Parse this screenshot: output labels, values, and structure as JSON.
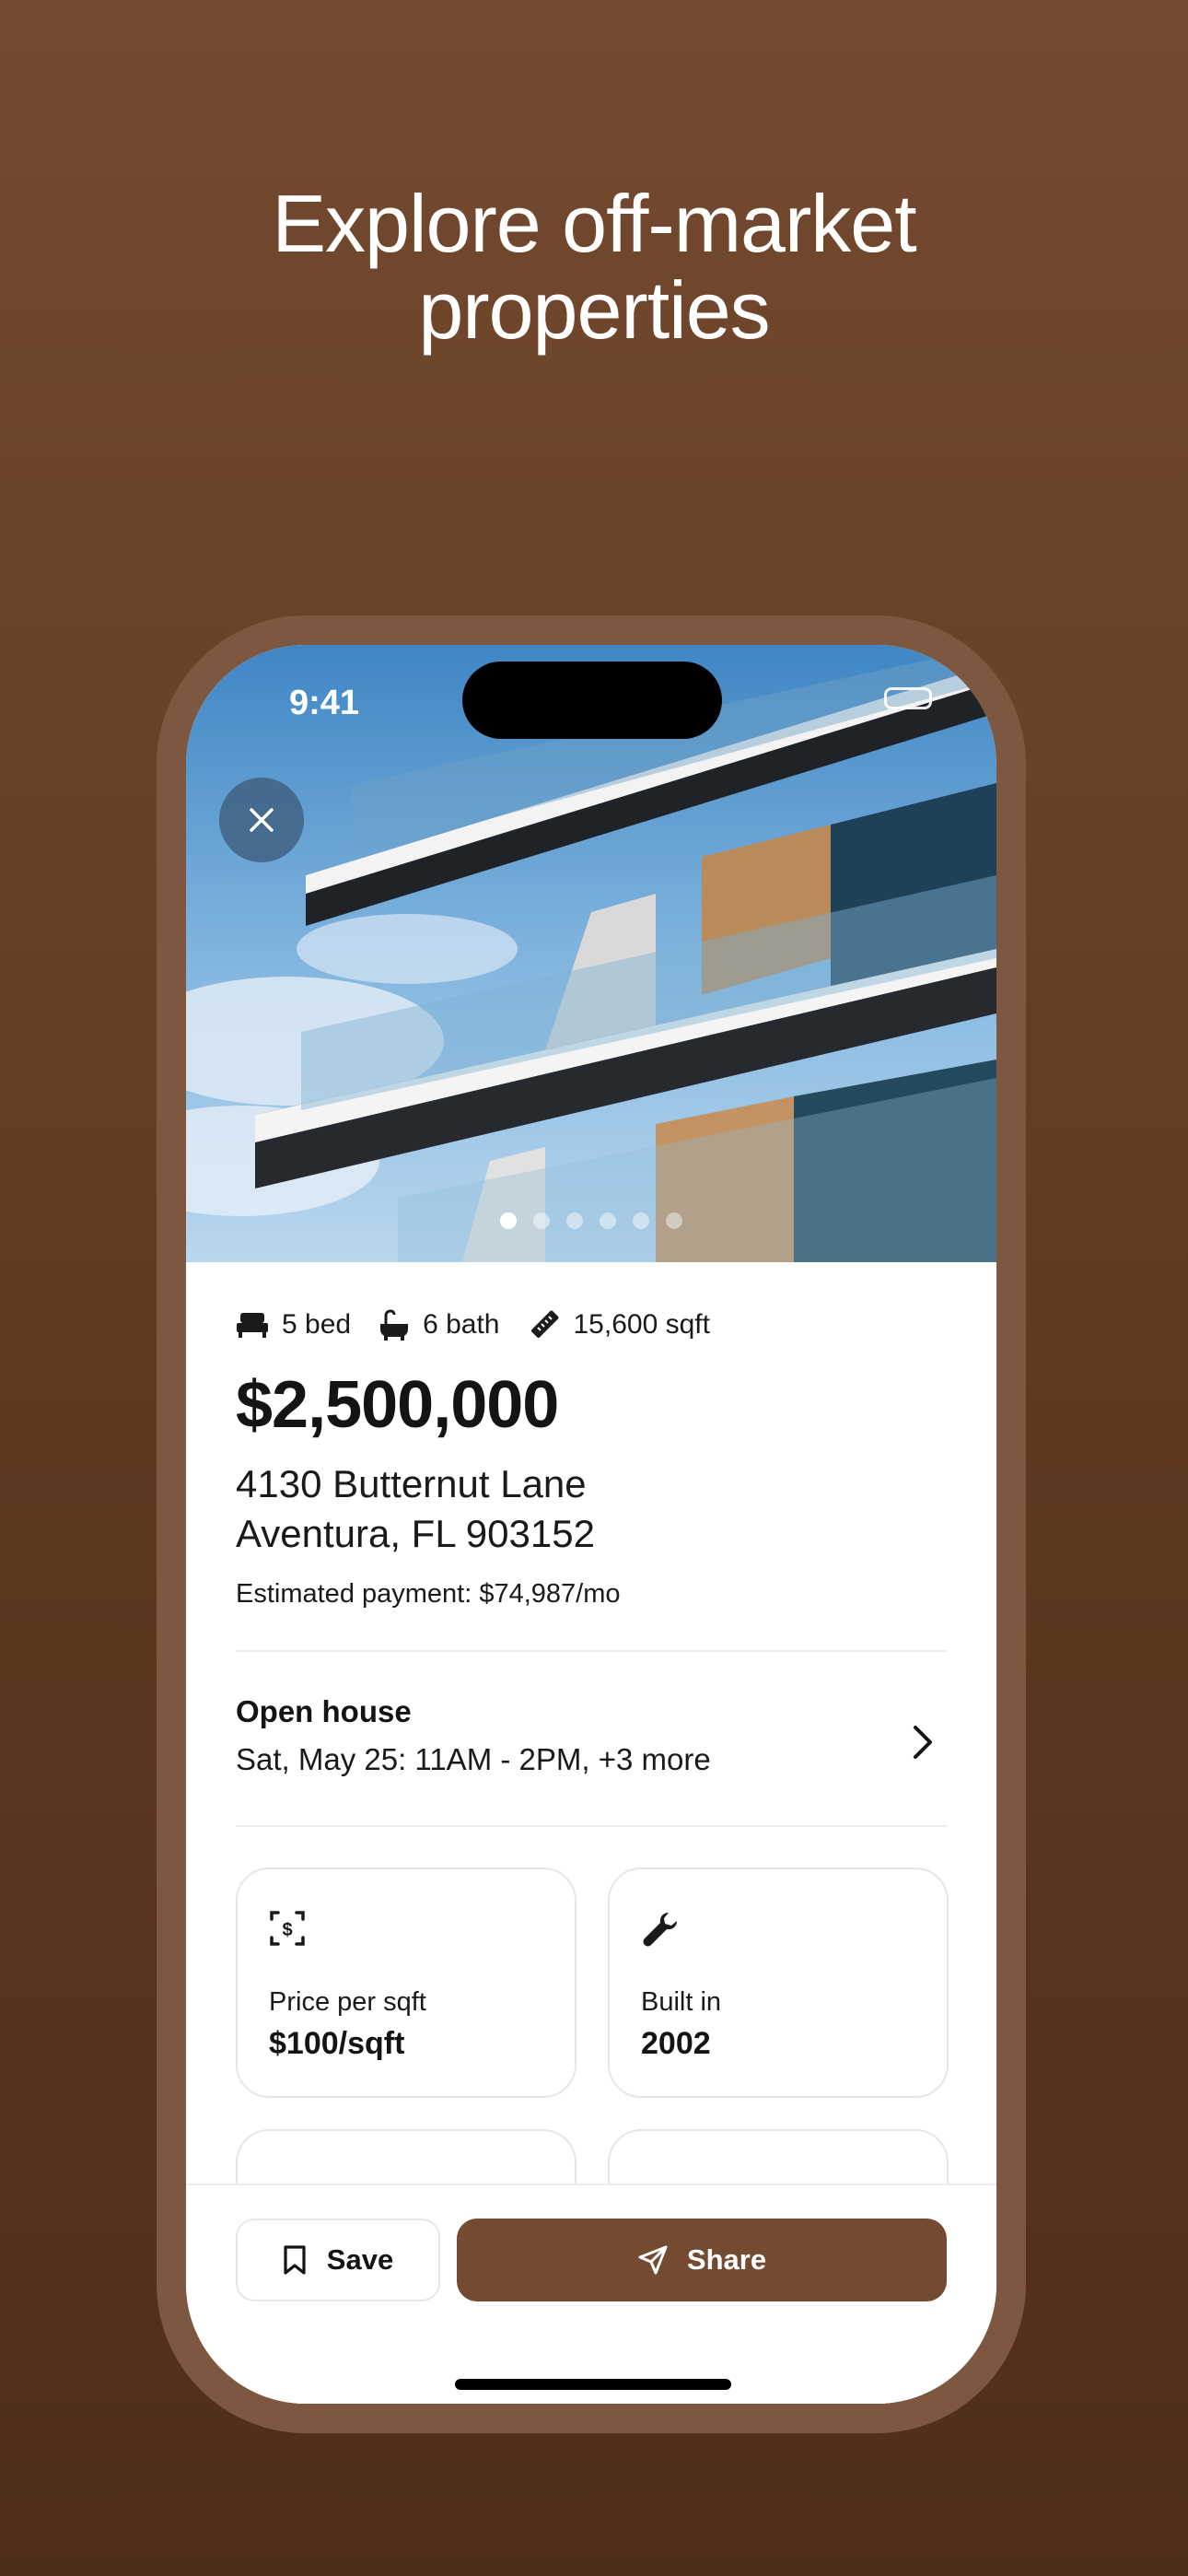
{
  "headline": {
    "line1": "Explore off-market",
    "line2": "properties"
  },
  "status_bar": {
    "time": "9:41"
  },
  "gallery": {
    "image_count": 6,
    "active_index": 0
  },
  "listing": {
    "beds": "5 bed",
    "baths": "6 bath",
    "area": "15,600 sqft",
    "price": "$2,500,000",
    "address_line1": "4130 Butternut Lane",
    "address_line2": "Aventura, FL 903152",
    "estimated_payment": "Estimated payment: $74,987/mo"
  },
  "open_house": {
    "title": "Open house",
    "schedule": "Sat, May 25: 11AM - 2PM, +3 more"
  },
  "details": [
    {
      "icon": "price-tag-icon",
      "label": "Price per sqft",
      "value": "$100/sqft"
    },
    {
      "icon": "wrench-icon",
      "label": "Built in",
      "value": "2002"
    }
  ],
  "actions": {
    "save_label": "Save",
    "share_label": "Share"
  },
  "colors": {
    "brand": "#744a30",
    "background": "#6a4128",
    "text": "#141414"
  }
}
